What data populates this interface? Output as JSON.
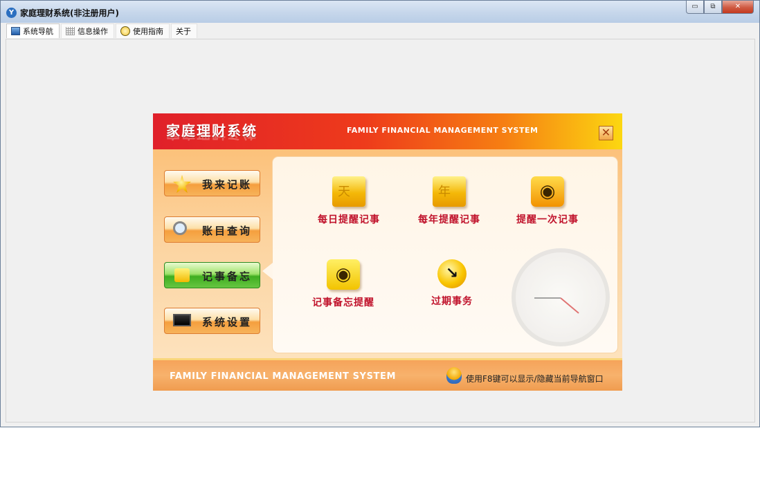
{
  "window": {
    "title": "家庭理财系统(非注册用户)",
    "buttons": {
      "minimize": "▭",
      "restore": "⧉",
      "close": "✕"
    }
  },
  "menubar": {
    "tabs": [
      {
        "label": "系统导航",
        "icon": "nav-icon"
      },
      {
        "label": "信息操作",
        "icon": "grid-icon"
      },
      {
        "label": "使用指南",
        "icon": "guide-icon"
      },
      {
        "label": "关于",
        "icon": ""
      }
    ]
  },
  "panel": {
    "title_cn": "家庭理财系统",
    "title_en": "FAMILY FINANCIAL MANAGEMENT SYSTEM",
    "close_glyph": "✕",
    "sidebar": [
      {
        "label": "我来记账",
        "icon": "star-icon"
      },
      {
        "label": "账目查询",
        "icon": "magnifier-icon"
      },
      {
        "label": "记事备忘",
        "icon": "rss-icon"
      },
      {
        "label": "系统设置",
        "icon": "monitor-icon"
      }
    ],
    "items": [
      {
        "label": "每日提醒记事",
        "icon": "folder-day-icon",
        "glyph": "天"
      },
      {
        "label": "每年提醒记事",
        "icon": "folder-year-icon",
        "glyph": "年"
      },
      {
        "label": "提醒一次记事",
        "icon": "rss-orange-icon",
        "glyph": "◉"
      },
      {
        "label": "记事备忘提醒",
        "icon": "rss-yellow-icon",
        "glyph": "◉"
      },
      {
        "label": "过期事务",
        "icon": "arrow-circle-icon",
        "glyph": "↘"
      }
    ],
    "footer_en": "FAMILY FINANCIAL MANAGEMENT SYSTEM",
    "footer_hint": "使用F8键可以显示/隐藏当前导航窗口"
  },
  "colors": {
    "header_start": "#e0202a",
    "header_end": "#fcd711",
    "item_label": "#c0122b",
    "active_button": "#3fae20"
  }
}
